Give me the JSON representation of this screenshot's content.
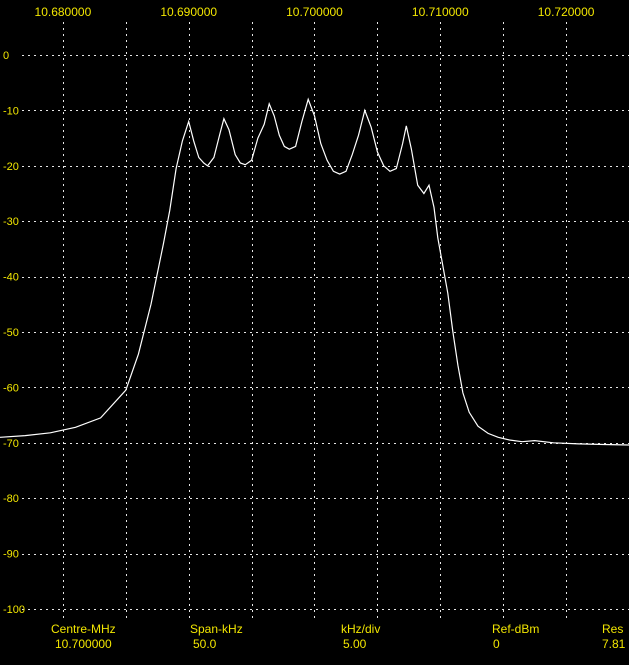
{
  "chart_data": {
    "type": "line",
    "x_tick_labels": [
      "10.680000",
      "10.690000",
      "10.700000",
      "10.710000",
      "10.720000"
    ],
    "x_tick_values": [
      10.68,
      10.69,
      10.7,
      10.71,
      10.72
    ],
    "y_tick_labels": [
      "0",
      "-10",
      "-20",
      "-30",
      "-40",
      "-50",
      "-60",
      "-70",
      "-80",
      "-90",
      "-100"
    ],
    "y_tick_values": [
      0,
      -10,
      -20,
      -30,
      -40,
      -50,
      -60,
      -70,
      -80,
      -90,
      -100
    ],
    "xlim": [
      10.675,
      10.725
    ],
    "ylim": [
      -100,
      0
    ],
    "grid": true,
    "series": [
      {
        "color": "#ffffff",
        "x": [
          10.675,
          10.677,
          10.679,
          10.681,
          10.683,
          10.685,
          10.686,
          10.687,
          10.688,
          10.6885,
          10.689,
          10.6895,
          10.69,
          10.6904,
          10.6908,
          10.6912,
          10.6915,
          10.692,
          10.6925,
          10.6928,
          10.6932,
          10.6937,
          10.6941,
          10.6945,
          10.695,
          10.6955,
          10.696,
          10.6964,
          10.6968,
          10.6972,
          10.6976,
          10.698,
          10.6985,
          10.699,
          10.6995,
          10.7,
          10.7005,
          10.701,
          10.7015,
          10.702,
          10.7025,
          10.703,
          10.7035,
          10.704,
          10.7045,
          10.705,
          10.7055,
          10.706,
          10.7065,
          10.707,
          10.7073,
          10.7077,
          10.7082,
          10.7087,
          10.7091,
          10.7095,
          10.7098,
          10.7102,
          10.7106,
          10.711,
          10.7114,
          10.7118,
          10.7123,
          10.713,
          10.7138,
          10.7146,
          10.7155,
          10.7165,
          10.7175,
          10.719,
          10.721,
          10.723,
          10.725
        ],
        "y": [
          -69.0,
          -68.7,
          -68.2,
          -67.2,
          -65.5,
          -60.5,
          -54.0,
          -45.0,
          -34.0,
          -28.0,
          -20.5,
          -15.5,
          -12.0,
          -15.5,
          -18.5,
          -19.5,
          -20.0,
          -18.5,
          -14.0,
          -11.5,
          -13.5,
          -18.0,
          -19.5,
          -19.8,
          -19.0,
          -15.0,
          -12.5,
          -8.8,
          -11.0,
          -14.5,
          -16.5,
          -17.0,
          -16.5,
          -12.0,
          -8.0,
          -11.0,
          -16.0,
          -19.0,
          -21.0,
          -21.5,
          -21.0,
          -18.0,
          -14.5,
          -10.0,
          -13.0,
          -17.5,
          -20.0,
          -21.0,
          -20.5,
          -16.0,
          -12.8,
          -17.0,
          -23.5,
          -25.0,
          -23.5,
          -27.5,
          -33.0,
          -38.0,
          -43.0,
          -50.0,
          -56.0,
          -61.0,
          -64.5,
          -67.0,
          -68.3,
          -69.0,
          -69.5,
          -69.8,
          -69.6,
          -70.0,
          -70.2,
          -70.3,
          -70.4
        ]
      }
    ]
  },
  "footer": {
    "centre_label": "Centre-MHz",
    "centre_value": "10.700000",
    "span_label": "Span-kHz",
    "span_value": "50.0",
    "div_label": "kHz/div",
    "div_value": "5.00",
    "ref_label": "Ref-dBm",
    "ref_value": "0",
    "res_label": "Res",
    "res_value": "7.81"
  }
}
